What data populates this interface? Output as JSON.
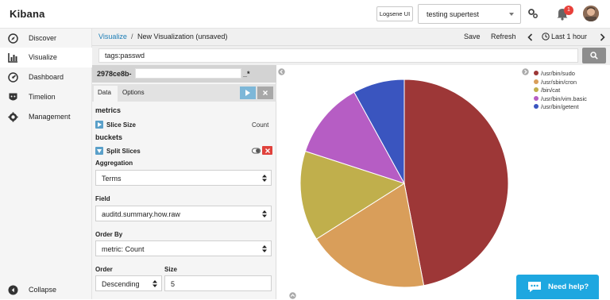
{
  "header": {
    "brand": "Kibana",
    "logsene_button": "Logsene UI",
    "app_select": "testing supertest",
    "notifications_count": "1"
  },
  "sidebar": {
    "items": [
      {
        "label": "Discover",
        "icon": "compass-icon"
      },
      {
        "label": "Visualize",
        "icon": "bar-chart-icon"
      },
      {
        "label": "Dashboard",
        "icon": "dashboard-icon"
      },
      {
        "label": "Timelion",
        "icon": "timelion-icon"
      },
      {
        "label": "Management",
        "icon": "gear-icon"
      }
    ],
    "collapse_label": "Collapse"
  },
  "breadcrumb": {
    "root": "Visualize",
    "separator": "/",
    "current": "New Visualization (unsaved)"
  },
  "toolbar": {
    "save": "Save",
    "refresh": "Refresh",
    "time": "Last 1 hour"
  },
  "search": {
    "query": "tags:passwd"
  },
  "editor": {
    "title_prefix": "2978ce8b-",
    "title_suffix": "_*",
    "tabs": [
      "Data",
      "Options"
    ],
    "metrics_heading": "metrics",
    "metric_label": "Slice Size",
    "metric_value": "Count",
    "buckets_heading": "buckets",
    "bucket_label": "Split Slices",
    "aggregation_label": "Aggregation",
    "aggregation_value": "Terms",
    "field_label": "Field",
    "field_value": "auditd.summary.how.raw",
    "orderby_label": "Order By",
    "orderby_value": "metric: Count",
    "order_label": "Order",
    "order_value": "Descending",
    "size_label": "Size",
    "size_value": "5"
  },
  "chart_data": {
    "type": "pie",
    "labels": [
      "/usr/bin/sudo",
      "/usr/sbin/cron",
      "/bin/cat",
      "/usr/bin/vim.basic",
      "/usr/bin/getent"
    ],
    "values": [
      47,
      19,
      14,
      12,
      8
    ],
    "colors": [
      "#9d3737",
      "#d99e5a",
      "#c0af4c",
      "#b65dc4",
      "#3a55bf"
    ],
    "legend_position": "top-right"
  },
  "help": {
    "label": "Need help?"
  }
}
